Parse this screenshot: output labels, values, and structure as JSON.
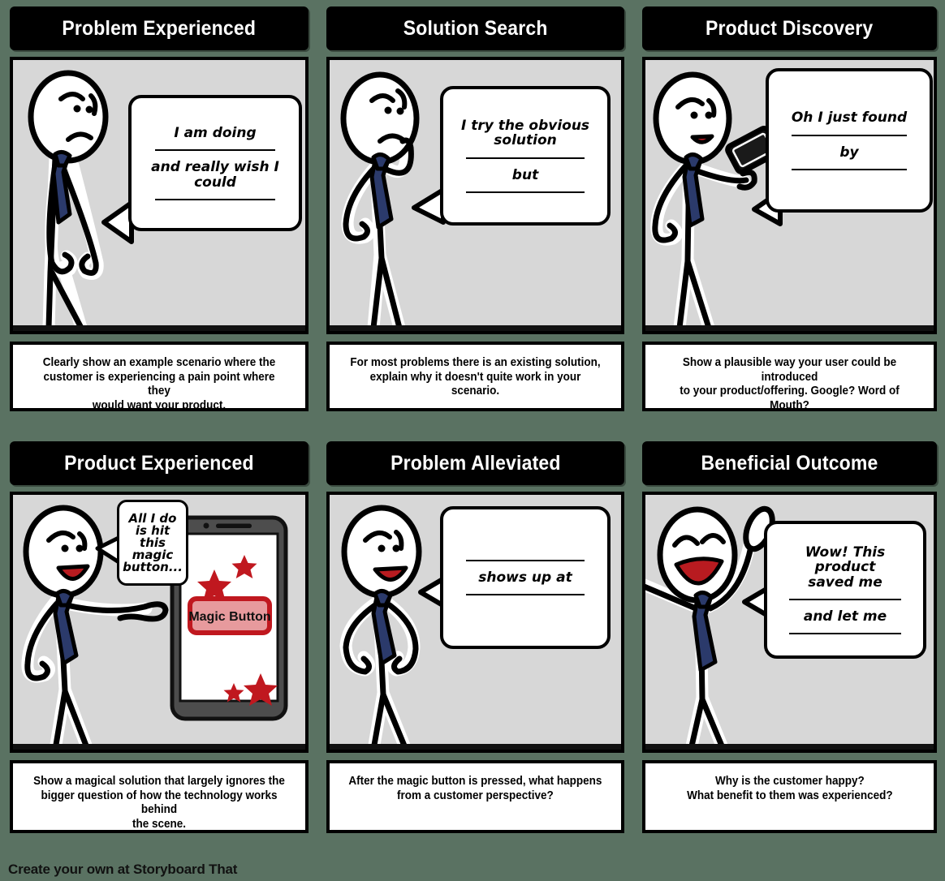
{
  "footer": {
    "text": "Create your own at Storyboard That"
  },
  "colors": {
    "background": "#5a7262",
    "title_bar": "#000000",
    "title_text": "#ffffff",
    "scene_bg": "#d7d7d7",
    "caption_bg": "#ffffff",
    "tie": "#2b3a6b",
    "mouth": "#b81b20",
    "star": "#c0181f",
    "magic_button_fill": "#e79a9d",
    "magic_button_border": "#c0181f",
    "phone_body": "#4d4d4d"
  },
  "panels": [
    {
      "title": "Problem Experienced",
      "caption": "Clearly show an example scenario where the\ncustomer is experiencing a pain point where they\nwould want your product.",
      "bubble_lines": [
        "I am doing",
        "___blank___",
        "and really wish I could",
        "___blank___"
      ],
      "bubble_text": {
        "l1": "I am doing",
        "l2": "and really wish I could"
      },
      "character": "sad-slumped-figure"
    },
    {
      "title": "Solution Search",
      "caption": "For most problems there is an existing solution,\nexplain why it doesn't quite work in your scenario.",
      "bubble_text": {
        "l1": "I try the obvious\nsolution",
        "l2": "but"
      },
      "character": "thinking-figure"
    },
    {
      "title": "Product Discovery",
      "caption": "Show a plausible way your user could be introduced\nto your product/offering. Google? Word of Mouth?",
      "bubble_text": {
        "l1": "Oh I just found",
        "l2": "by"
      },
      "character": "figure-with-phone"
    },
    {
      "title": "Product Experienced",
      "caption": "Show a magical solution that largely ignores the\nbigger question of how the technology works behind\nthe scene.",
      "bubble_text": {
        "l1": "All I do\nis hit\nthis\nmagic\nbutton..."
      },
      "character": "figure-pointing",
      "phone": {
        "button_label": "Magic Button"
      }
    },
    {
      "title": "Problem Alleviated",
      "caption": "After the magic button is pressed, what happens\nfrom a customer perspective?",
      "bubble_text": {
        "l1": "shows up at"
      },
      "character": "hands-on-hips-figure"
    },
    {
      "title": "Beneficial Outcome",
      "caption": "Why is the customer happy?\nWhat benefit to them was experienced?",
      "bubble_text": {
        "l1": "Wow! This product\nsaved me",
        "l2": "and let me"
      },
      "character": "celebrating-figure"
    }
  ]
}
